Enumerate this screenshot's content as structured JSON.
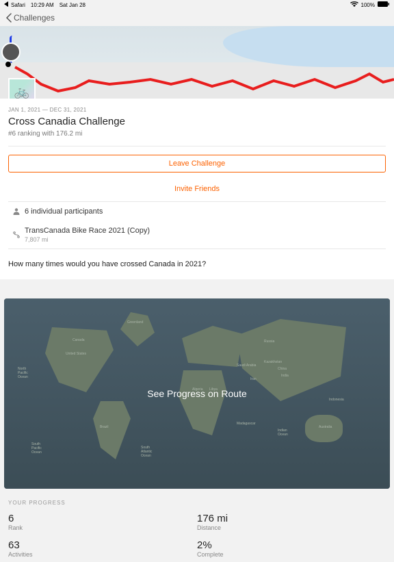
{
  "status_bar": {
    "back_app": "Safari",
    "time": "10:29 AM",
    "date": "Sat Jan 28",
    "battery_pct": "100%"
  },
  "nav": {
    "back_label": "Challenges"
  },
  "challenge": {
    "dates": "JAN 1, 2021 — DEC 31, 2021",
    "title": "Cross Canadia Challenge",
    "subtitle": "#6 ranking with 176.2 mi",
    "leave_label": "Leave Challenge",
    "invite_label": "Invite Friends",
    "participants": "6 individual participants",
    "route_name": "TransCanada Bike Race 2021 (Copy)",
    "route_distance": "7,807 mi",
    "question": "How many times would you have crossed Canada in 2021?",
    "progress_cta": "See Progress on Route"
  },
  "progress": {
    "heading": "YOUR PROGRESS",
    "stats": [
      {
        "value": "6",
        "label": "Rank"
      },
      {
        "value": "176 mi",
        "label": "Distance"
      },
      {
        "value": "63",
        "label": "Activities"
      },
      {
        "value": "2%",
        "label": "Complete"
      }
    ]
  }
}
